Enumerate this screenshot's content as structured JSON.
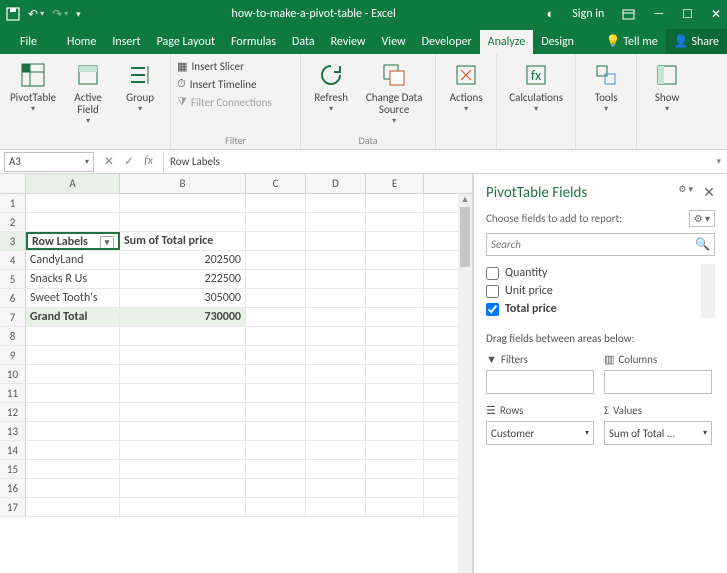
{
  "titlebar": {
    "title": "how-to-make-a-pivot-table - Excel",
    "signin": "Sign in"
  },
  "tabs": [
    "File",
    "Home",
    "Insert",
    "Page Layout",
    "Formulas",
    "Data",
    "Review",
    "View",
    "Developer",
    "Analyze",
    "Design"
  ],
  "tellme": "Tell me",
  "share": "Share",
  "ribbon": {
    "pivottable": "PivotTable",
    "activefield": "Active\nField",
    "group": "Group",
    "insert_slicer": "Insert Slicer",
    "insert_timeline": "Insert Timeline",
    "filter_connections": "Filter Connections",
    "filter_label": "Filter",
    "refresh": "Refresh",
    "change_data": "Change Data\nSource",
    "data_label": "Data",
    "actions": "Actions",
    "calculations": "Calculations",
    "tools": "Tools",
    "show": "Show"
  },
  "namebox": "A3",
  "formula": "Row Labels",
  "columns": [
    "A",
    "B",
    "C",
    "D",
    "E"
  ],
  "sheet": {
    "rows": [
      {
        "n": 1,
        "a": "",
        "b": ""
      },
      {
        "n": 2,
        "a": "",
        "b": ""
      },
      {
        "n": 3,
        "a": "Row Labels",
        "b": "Sum of Total price",
        "header": true
      },
      {
        "n": 4,
        "a": "CandyLand",
        "b": "202500"
      },
      {
        "n": 5,
        "a": "Snacks R Us",
        "b": "222500"
      },
      {
        "n": 6,
        "a": "Sweet Tooth's",
        "b": "305000"
      },
      {
        "n": 7,
        "a": "Grand Total",
        "b": "730000",
        "bold": true
      },
      {
        "n": 8
      },
      {
        "n": 9
      },
      {
        "n": 10
      },
      {
        "n": 11
      },
      {
        "n": 12
      },
      {
        "n": 13
      },
      {
        "n": 14
      },
      {
        "n": 15
      },
      {
        "n": 16
      },
      {
        "n": 17
      }
    ]
  },
  "panel": {
    "title": "PivotTable Fields",
    "choose": "Choose fields to add to report:",
    "search_ph": "Search",
    "fields": [
      {
        "label": "Quantity",
        "checked": false
      },
      {
        "label": "Unit price",
        "checked": false
      },
      {
        "label": "Total price",
        "checked": true
      }
    ],
    "drag": "Drag fields between areas below:",
    "areas": {
      "filters": "Filters",
      "columns": "Columns",
      "rows": "Rows",
      "rows_val": "Customer",
      "values": "Values",
      "values_val": "Sum of Total ..."
    }
  },
  "chart_data": {
    "type": "table",
    "title": "Sum of Total price by Customer",
    "categories": [
      "CandyLand",
      "Snacks R Us",
      "Sweet Tooth's"
    ],
    "values": [
      202500,
      222500,
      305000
    ],
    "grand_total": 730000
  }
}
